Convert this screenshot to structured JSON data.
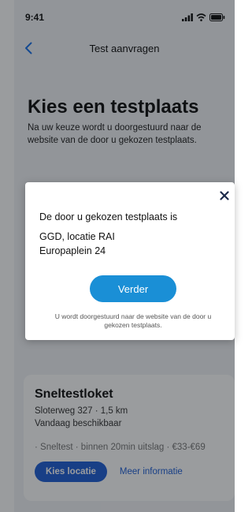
{
  "status_bar": {
    "time": "9:41"
  },
  "nav": {
    "title": "Test aanvragen"
  },
  "page": {
    "heading": "Kies een testplaats",
    "subtitle": "Na uw keuze wordt u doorgestuurd naar de website van de door u gekozen testplaats."
  },
  "location_card": {
    "name": "Sneltestloket",
    "address": "Sloterweg 327 · 1,5 km",
    "availability": "Vandaag beschikbaar",
    "details": "· Sneltest · binnen 20min uitslag · €33-€69",
    "choose_label": "Kies locatie",
    "more_info_label": "Meer informatie"
  },
  "modal": {
    "heading": "De door u gekozen testplaats is",
    "location_line1": "GGD, locatie RAI",
    "location_line2": "Europaplein 24",
    "continue_label": "Verder",
    "note": "U wordt doorgestuurd naar de website van de door u gekozen testplaats."
  },
  "colors": {
    "primary_button": "#1a8fd6",
    "nav_accent": "#1a73e8",
    "card_button": "#1f5fd6"
  }
}
